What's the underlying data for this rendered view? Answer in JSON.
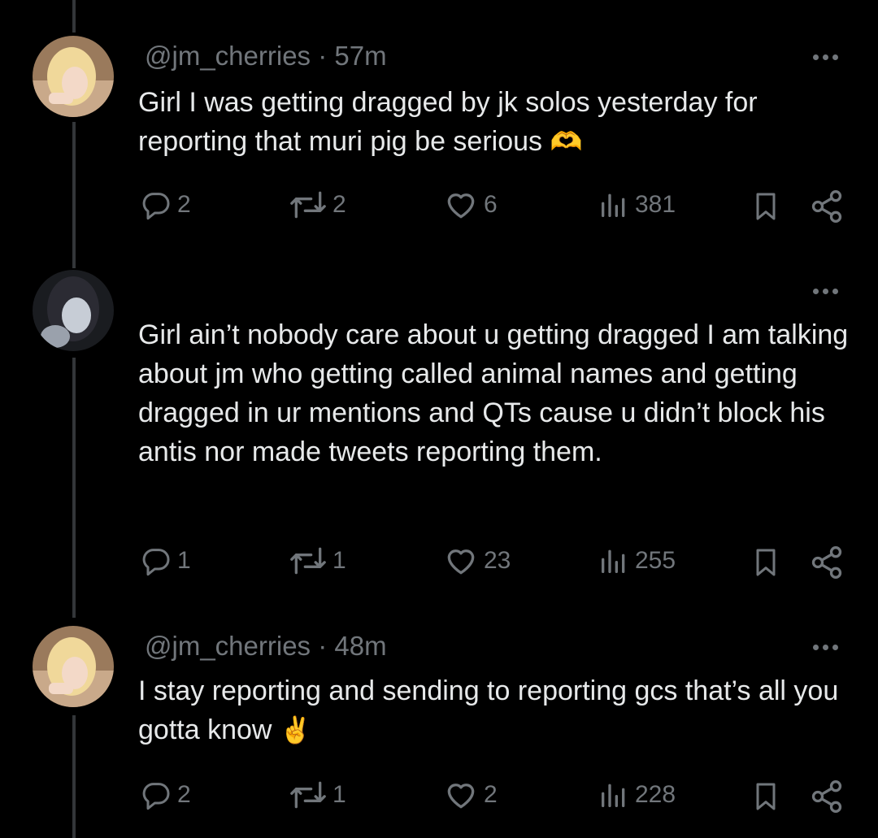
{
  "tweets": [
    {
      "handle": "@jm_cherries",
      "time": "57m",
      "text": "Girl I was getting dragged by jk solos yesterday for reporting that muri pig be serious",
      "emoji": "🫶",
      "replies": "2",
      "reposts": "2",
      "likes": "6",
      "views": "381"
    },
    {
      "handle": "",
      "time": "",
      "text": "Girl ain’t nobody care about u getting dragged I am talking about jm who getting called animal names and getting dragged in ur mentions and QTs cause u didn’t block his antis nor made tweets reporting them.",
      "replies": "1",
      "reposts": "1",
      "likes": "23",
      "views": "255"
    },
    {
      "handle": "@jm_cherries",
      "time": "48m",
      "text": "I stay reporting and sending to reporting gcs that’s all you gotta know",
      "emoji": "✌️",
      "replies": "2",
      "reposts": "1",
      "likes": "2",
      "views": "228"
    }
  ],
  "separator": "·",
  "colors": {
    "background": "#000000",
    "text": "#e7e9ea",
    "muted": "#71767b",
    "thread_line": "#333639"
  },
  "icons": [
    "reply-icon",
    "repost-icon",
    "like-icon",
    "views-icon",
    "bookmark-icon",
    "share-icon",
    "more-icon"
  ]
}
